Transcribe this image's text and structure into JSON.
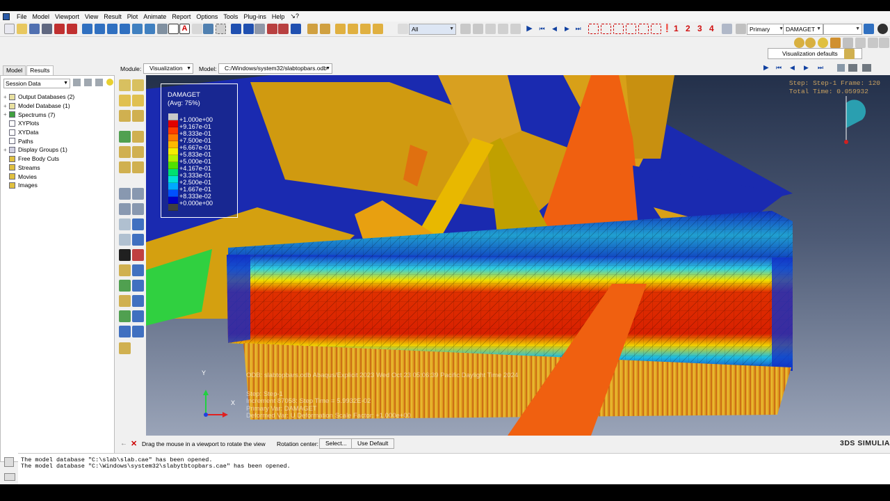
{
  "menu": [
    "File",
    "Model",
    "Viewport",
    "View",
    "Result",
    "Plot",
    "Animate",
    "Report",
    "Options",
    "Tools",
    "Plug-ins",
    "Help",
    "↘?"
  ],
  "toolbar": {
    "selection_filter": "All",
    "field_output_type": "Primary",
    "field_output_var": "DAMAGET",
    "frame_numbers": [
      "1",
      "2",
      "3",
      "4"
    ]
  },
  "visualization_defaults": "Visualization defaults",
  "panel": {
    "tabs": [
      "Model",
      "Results"
    ],
    "session_select": "Session Data",
    "tree": [
      {
        "label": "Output Databases (2)",
        "expand": "+"
      },
      {
        "label": "Model Database (1)",
        "expand": "+"
      },
      {
        "label": "Spectrums (7)",
        "expand": "+"
      },
      {
        "label": "XYPlots",
        "expand": ""
      },
      {
        "label": "XYData",
        "expand": ""
      },
      {
        "label": "Paths",
        "expand": ""
      },
      {
        "label": "Display Groups (1)",
        "expand": "+"
      },
      {
        "label": "Free Body Cuts",
        "expand": ""
      },
      {
        "label": "Streams",
        "expand": ""
      },
      {
        "label": "Movies",
        "expand": ""
      },
      {
        "label": "Images",
        "expand": ""
      }
    ]
  },
  "module_bar": {
    "module_label": "Module:",
    "module_value": "Visualization",
    "model_label": "Model:",
    "model_value": "C:/Windows/system32/slabtopbars.odb"
  },
  "legend": {
    "title": "DAMAGET",
    "subtitle": "(Avg: 75%)",
    "values": [
      "+1.000e+00",
      "+9.167e-01",
      "+8.333e-01",
      "+7.500e-01",
      "+6.667e-01",
      "+5.833e-01",
      "+5.000e-01",
      "+4.167e-01",
      "+3.333e-01",
      "+2.500e-01",
      "+1.667e-01",
      "+8.333e-02",
      "+0.000e+00"
    ],
    "colors": [
      "#c8c8c8",
      "#e00000",
      "#ff3c00",
      "#ff7a00",
      "#ffb800",
      "#f4ec00",
      "#b4f000",
      "#50e000",
      "#00e070",
      "#00e0d8",
      "#00a8ff",
      "#0050ff",
      "#0000c8",
      "#404040"
    ]
  },
  "step_info": {
    "line1": "Step: Step-1   Frame: 120",
    "line2": "Total Time: 0.059932"
  },
  "viewport_meta": {
    "odb_line": "ODB: slabtopbars.odb    Abaqus/Explicit 2023    Wed Oct 23 05:06:39 Pacific Daylight Time 2024",
    "step_line": "Step: Step-1",
    "increment_line": "Increment    87058: Step Time =    5.9932E-02",
    "primary_line": "Primary Var: DAMAGET",
    "deformed_line": "Deformed Var: U   Deformation Scale Factor: +1.000e+00"
  },
  "triad": {
    "y": "Y",
    "x": "X"
  },
  "prompt": {
    "text": "Drag the mouse in a viewport to rotate the view",
    "rotation_label": "Rotation center:",
    "select_button": "Select...",
    "default_button": "Use Default"
  },
  "brand": "3DS SIMULIA",
  "messages": [
    "The model database \"C:\\slab\\slab.cae\" has been opened.",
    "The model database \"C:\\Windows\\system32\\slabytbtopbars.cae\" has been opened."
  ]
}
